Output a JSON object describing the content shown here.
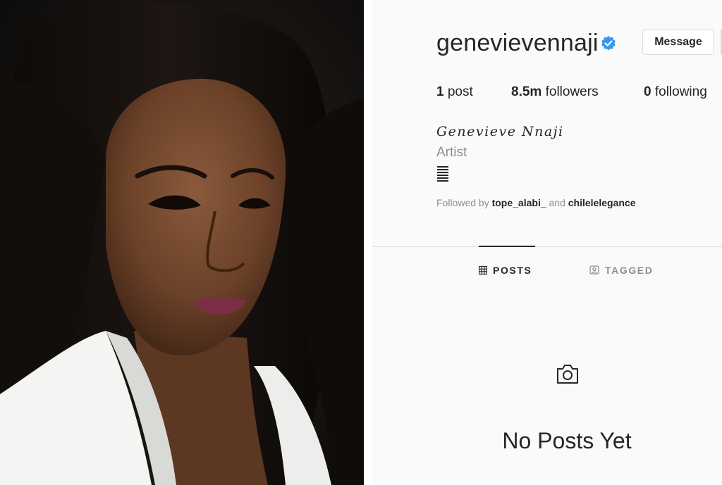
{
  "profile": {
    "username": "genevievennaji",
    "verified_icon": "verified-badge-icon",
    "verified_color": "#3897f0",
    "message_label": "Message",
    "stats": {
      "posts_count": "1",
      "posts_label": "post",
      "followers_count": "8.5m",
      "followers_label": "followers",
      "following_count": "0",
      "following_label": "following"
    },
    "full_name": "Genevieve Nnaji",
    "category": "Artist",
    "followed_by_prefix": "Followed by",
    "followed_by_user1": "tope_alabi_",
    "followed_by_joiner": "and",
    "followed_by_user2": "chilelelegance"
  },
  "tabs": {
    "posts_label": "POSTS",
    "posts_icon": "grid-icon",
    "tagged_label": "TAGGED",
    "tagged_icon": "tag-person-icon"
  },
  "empty_state": {
    "icon": "camera-icon",
    "title": "No Posts Yet"
  },
  "colors": {
    "text_primary": "#262626",
    "text_secondary": "#8e8e8e",
    "border": "#dbdbdb",
    "background": "#fafafa"
  }
}
